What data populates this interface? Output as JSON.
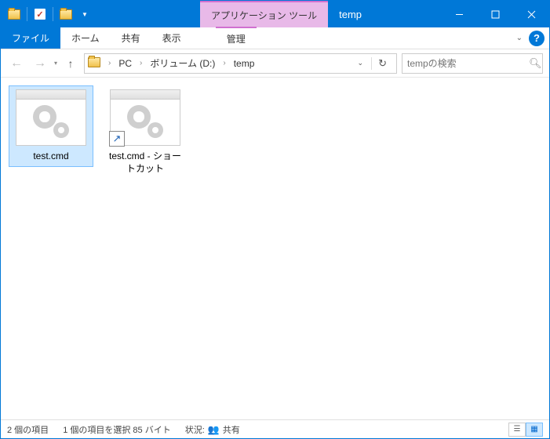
{
  "titlebar": {
    "contextual_tab": "アプリケーション ツール",
    "title": "temp"
  },
  "ribbon": {
    "file": "ファイル",
    "home": "ホーム",
    "share": "共有",
    "view": "表示",
    "manage": "管理"
  },
  "breadcrumb": {
    "items": [
      "PC",
      "ボリューム (D:)",
      "temp"
    ]
  },
  "search": {
    "placeholder": "tempの検索"
  },
  "files": [
    {
      "name": "test.cmd",
      "selected": true,
      "shortcut": false
    },
    {
      "name": "test.cmd - ショートカット",
      "selected": false,
      "shortcut": true
    }
  ],
  "statusbar": {
    "item_count": "2 個の項目",
    "selection": "1 個の項目を選択 85 バイト",
    "situation_label": "状況:",
    "share": "共有"
  }
}
